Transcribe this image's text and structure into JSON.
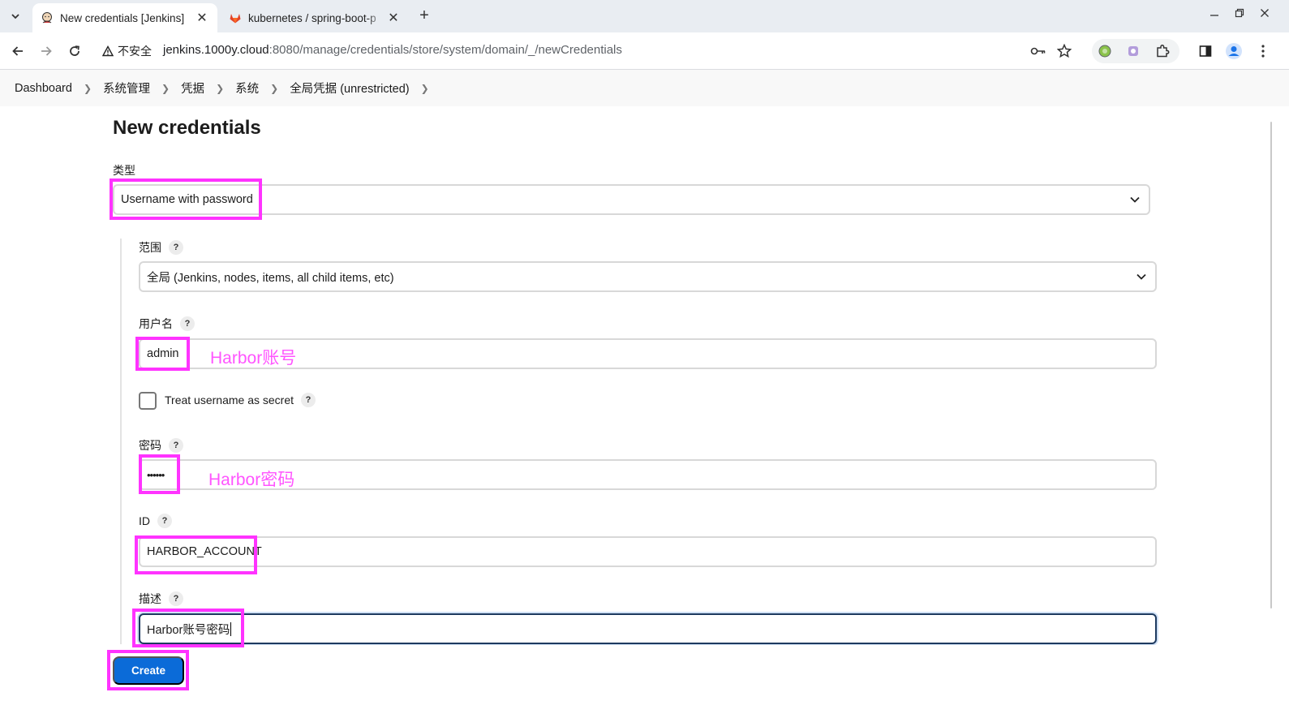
{
  "browser": {
    "tabs": [
      {
        "title": "New credentials [Jenkins]",
        "active": true,
        "icon": "jenkins-icon"
      },
      {
        "title": "kubernetes / spring-boot-p",
        "active": false,
        "icon": "gitlab-icon"
      }
    ],
    "security_label": "不安全",
    "url_host": "jenkins.1000y.cloud",
    "url_path": ":8080/manage/credentials/store/system/domain/_/newCredentials"
  },
  "breadcrumb": [
    "Dashboard",
    "系统管理",
    "凭据",
    "系统",
    "全局凭据 (unrestricted)"
  ],
  "page": {
    "title": "New credentials",
    "kind_label": "类型",
    "kind_value": "Username with password",
    "scope_label": "范围",
    "scope_value": "全局 (Jenkins, nodes, items, all child items, etc)",
    "username_label": "用户名",
    "username_value": "admin",
    "treat_secret_label": "Treat username as secret",
    "password_label": "密码",
    "password_value": "••••••",
    "id_label": "ID",
    "id_value": "HARBOR_ACCOUNT",
    "description_label": "描述",
    "description_value": "Harbor账号密码",
    "create_label": "Create",
    "help_glyph": "?"
  },
  "annotations": {
    "username_note": "Harbor账号",
    "password_note": "Harbor密码",
    "color": "#ff33ff"
  },
  "colors": {
    "primary_button": "#0b6bd8",
    "annotation": "#ff33ff"
  }
}
